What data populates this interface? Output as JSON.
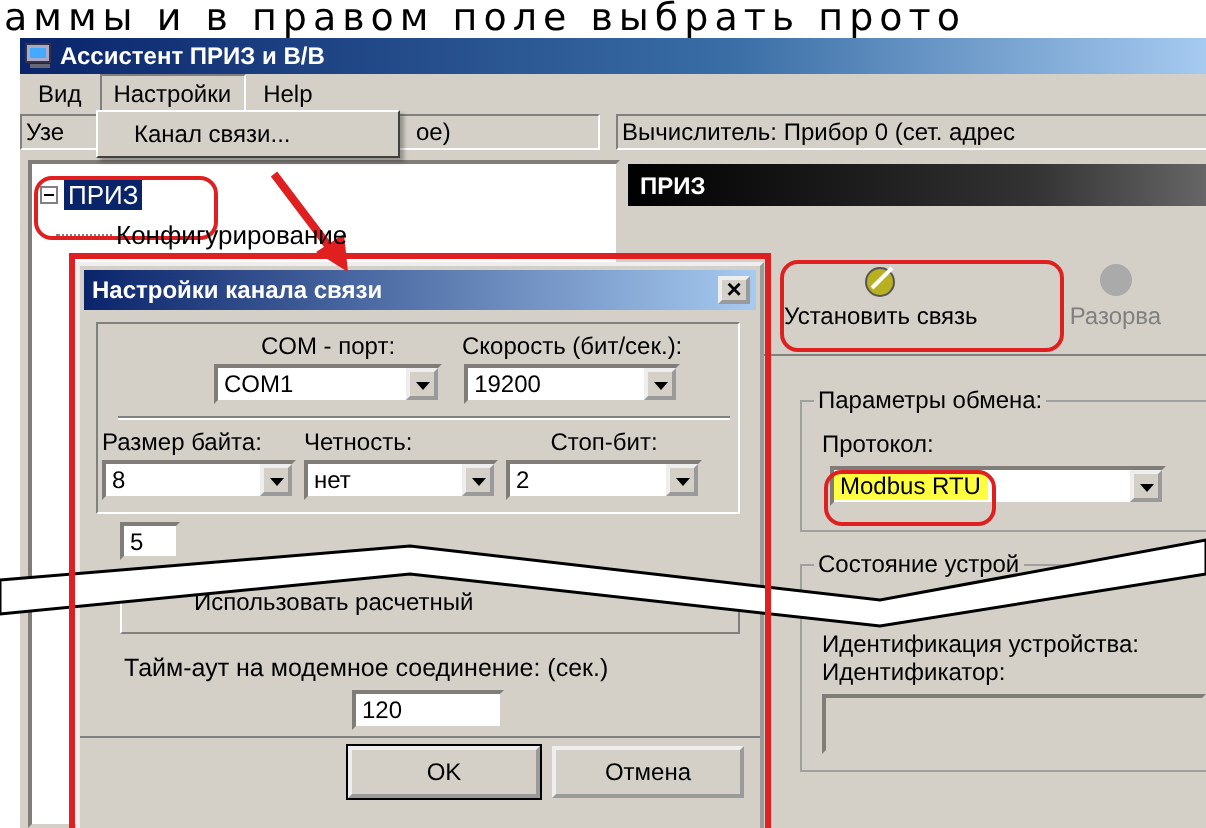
{
  "caption": "аммы и в правом поле выбрать прото",
  "window": {
    "title": "Ассистент ПРИЗ и В/В",
    "menu": [
      {
        "label": "Вид",
        "selected": false
      },
      {
        "label": "Настройки",
        "selected": true
      },
      {
        "label": "Help",
        "selected": false
      }
    ],
    "dropdown": [
      {
        "label": "Канал связи..."
      }
    ],
    "status": {
      "node": "Узе",
      "node_tail": "ое)",
      "computer": "Вычислитель: Прибор 0 (сет. адрес"
    },
    "tree": [
      {
        "label": "ПРИЗ",
        "selected": true,
        "expanded": true,
        "children": [
          {
            "label": "Конфигурирование"
          }
        ]
      }
    ],
    "panel_header": "ПРИЗ",
    "toolbar": [
      {
        "label": "Установить связь",
        "disabled": false
      },
      {
        "label": "Разорва",
        "disabled": true
      }
    ],
    "params": {
      "legend": "Параметры обмена:",
      "protocol_label": "Протокол:",
      "protocol": "Modbus RTU"
    },
    "device": {
      "legend": "Состояние устрой",
      "identification": "Идентификация устройства:",
      "identifier_label": "Идентификатор:"
    }
  },
  "dialog": {
    "title": "Настройки канала связи",
    "close": "×",
    "com_label": "COM - порт:",
    "com": "COM1",
    "speed_label": "Скорость (бит/сек.):",
    "speed": "19200",
    "byte_label": "Размер байта:",
    "byte": "8",
    "parity_label": "Четность:",
    "parity": "нет",
    "stop_label": "Стоп-бит:",
    "stop": "2",
    "retries": "5",
    "use_calc_label": "Использовать расчетный",
    "timeout_label": "Тайм-аут на модемное соединение: (сек.)",
    "timeout": "120",
    "buttons": [
      "OK",
      "Отмена"
    ]
  }
}
